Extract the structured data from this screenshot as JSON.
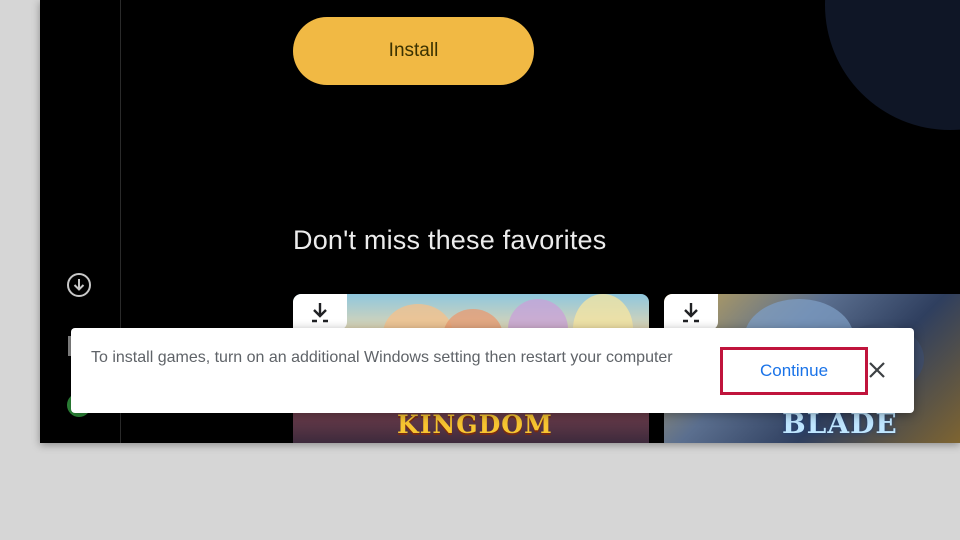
{
  "hero": {
    "install_label": "Install"
  },
  "section": {
    "title": "Don't miss these favorites"
  },
  "games": [
    {
      "logo_text": "KINGDOM",
      "icon": "download-icon"
    },
    {
      "logo_text": "BLADE",
      "icon": "download-icon"
    }
  ],
  "sidebar": {
    "icons": [
      "download-circle-icon",
      "library-icon",
      "avatar"
    ]
  },
  "toast": {
    "message": "To install games, turn on an additional Windows setting then restart your computer",
    "continue_label": "Continue",
    "close_icon": "close-icon"
  },
  "colors": {
    "install_button": "#f1b944",
    "continue_text": "#1a73e8",
    "highlight_border": "#c0143c",
    "app_background": "#000000"
  }
}
